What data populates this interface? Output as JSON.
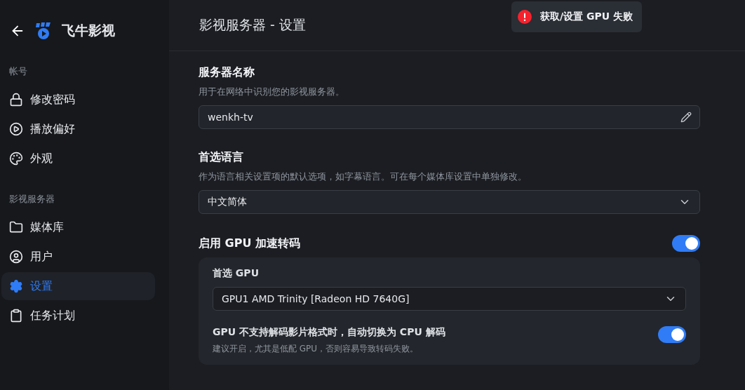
{
  "app": {
    "name": "飞牛影视"
  },
  "sidebar": {
    "groups": [
      {
        "heading": "帐号",
        "items": [
          {
            "label": "修改密码",
            "selected": false
          },
          {
            "label": "播放偏好",
            "selected": false
          },
          {
            "label": "外观",
            "selected": false
          }
        ]
      },
      {
        "heading": "影视服务器",
        "items": [
          {
            "label": "媒体库",
            "selected": false
          },
          {
            "label": "用户",
            "selected": false
          },
          {
            "label": "设置",
            "selected": true
          },
          {
            "label": "任务计划",
            "selected": false
          }
        ]
      }
    ]
  },
  "page": {
    "title": "影视服务器 - 设置"
  },
  "toast": {
    "message": "获取/设置 GPU 失败"
  },
  "server_name": {
    "title": "服务器名称",
    "description": "用于在网络中识别您的影视服务器。",
    "value": "wenkh-tv"
  },
  "language": {
    "title": "首选语言",
    "description": "作为语言相关设置项的默认选项，如字幕语言。可在每个媒体库设置中单独修改。",
    "value": "中文简体"
  },
  "gpu": {
    "title": "启用 GPU 加速转码",
    "on": true,
    "preferred": {
      "label": "首选 GPU",
      "value": "GPU1 AMD Trinity [Radeon HD 7640G]"
    },
    "fallback": {
      "title": "GPU 不支持解码影片格式时，自动切换为 CPU 解码",
      "description": "建议开启，尤其是低配 GPU，否则容易导致转码失败。",
      "on": true
    }
  }
}
